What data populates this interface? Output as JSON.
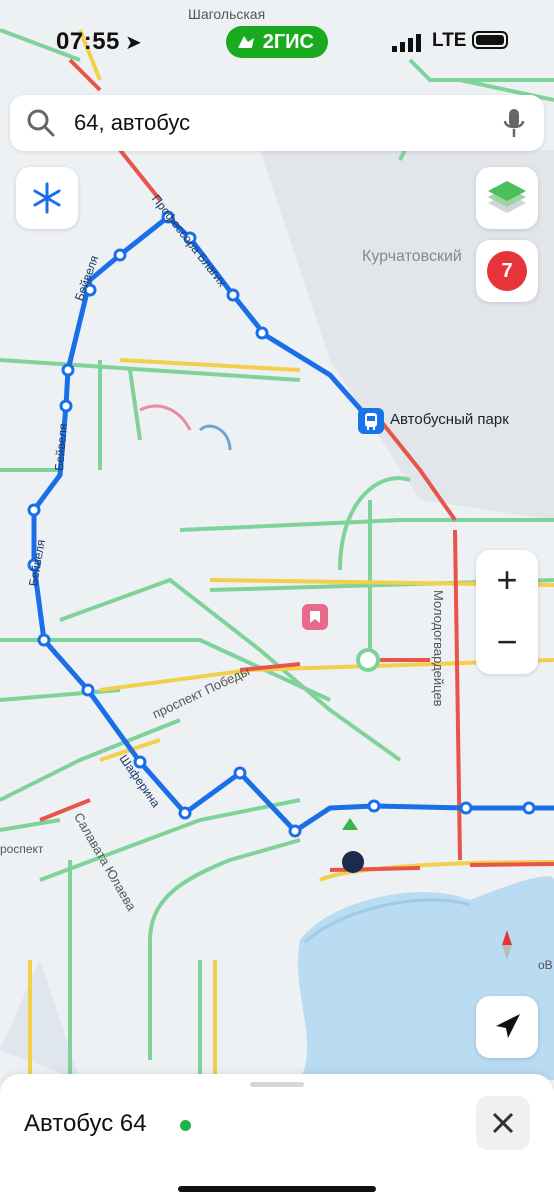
{
  "status": {
    "time": "07:55",
    "network": "LTE",
    "brand": "2ГИС"
  },
  "search": {
    "query": "64, автобус"
  },
  "map": {
    "labels": {
      "street_top": "Шагольская",
      "district": "Курчатовский",
      "bus_stop": "Автобусный парк",
      "avenue": "проспект Победы",
      "street_right": "Молодогвардейцев",
      "street_left": "Салавата Юлаева",
      "edge_left": "роспект",
      "edge_right": "оВ",
      "route_street_1": "Профессора Благих",
      "route_street_2": "Бейвеля",
      "route_street_3": "Бейвеля",
      "route_street_4": "Бейвеля",
      "route_street_5": "Шаферина"
    },
    "traffic_count": "7",
    "route_color": "#1a6fe8"
  },
  "controls": {
    "zoom_in": "+",
    "zoom_out": "−"
  },
  "sheet": {
    "title": "Автобус 64",
    "close": "✕"
  }
}
